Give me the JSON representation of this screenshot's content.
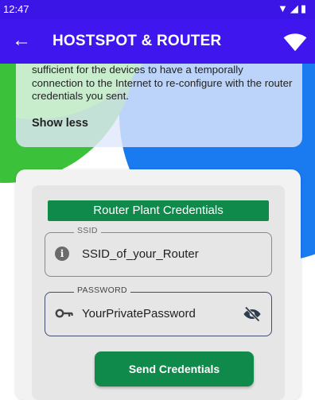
{
  "status_bar": {
    "time": "12:47",
    "icons": [
      "wifi-signal-icon",
      "cell-signal-icon",
      "battery-icon"
    ]
  },
  "app_bar": {
    "title": "HOSTSPOT & ROUTER",
    "back_icon": "arrow-left-icon",
    "action_icon": "wifi-icon"
  },
  "info_card": {
    "text": "sufficient for the devices to have a temporally connection to the Internet to re-configure with the router credentials you sent.",
    "show_less_label": "Show less"
  },
  "credentials": {
    "header": "Router Plant Credentials",
    "ssid": {
      "label": "SSID",
      "value": "SSID_of_your_Router",
      "icon": "info-icon"
    },
    "password": {
      "label": "PASSWORD",
      "value": "YourPrivatePassword",
      "icon": "key-icon",
      "toggle_icon": "eye-off-icon"
    },
    "send_label": "Send Credentials"
  },
  "colors": {
    "app_bar": "#3f17ee",
    "status_bar": "#3b14e6",
    "blue_decor": "#1a7af0",
    "green_decor": "#3cc23a",
    "primary_green": "#0f8a4b"
  }
}
